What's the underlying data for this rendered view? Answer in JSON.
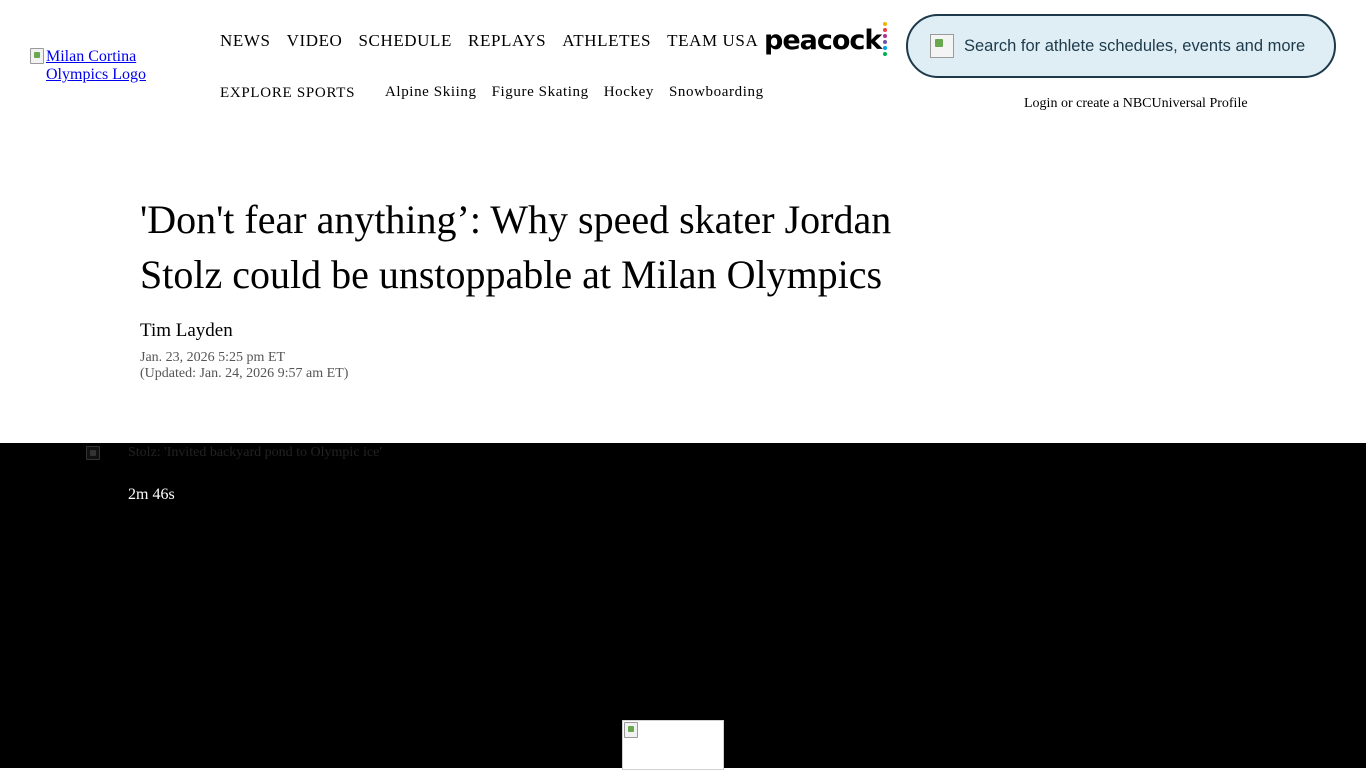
{
  "header": {
    "logo_alt": "Milan Cortina Olympics Logo",
    "nav_main": [
      "NEWS",
      "VIDEO",
      "SCHEDULE",
      "REPLAYS",
      "ATHLETES",
      "TEAM USA"
    ],
    "peacock_label": "peacock",
    "peacock_colors": [
      "#f6b000",
      "#ef3e42",
      "#b0308f",
      "#6e55a3",
      "#00a5e4",
      "#00b050"
    ],
    "explore_label": "EXPLORE SPORTS",
    "sports": [
      "Alpine Skiing",
      "Figure Skating",
      "Hockey",
      "Snowboarding"
    ],
    "search_placeholder": "Search for athlete schedules, events and more",
    "login_text": "Login or create a NBCUniversal Profile"
  },
  "article": {
    "headline": "'Don't fear anything’: Why speed skater Jordan Stolz could be unstoppable at Milan Olympics",
    "author": "Tim Layden",
    "published": "Jan. 23, 2026 5:25 pm ET",
    "updated": "(Updated: Jan. 24, 2026 9:57 am ET)"
  },
  "video": {
    "thumbnail_alt": "Stolz: 'Invited backyard pond to Olympic ice'",
    "duration": "2m 46s"
  },
  "colors": {
    "link": "#0000ee",
    "search_bg": "#dfeef5",
    "search_border": "#1d3a4a",
    "video_bg": "#000000"
  }
}
